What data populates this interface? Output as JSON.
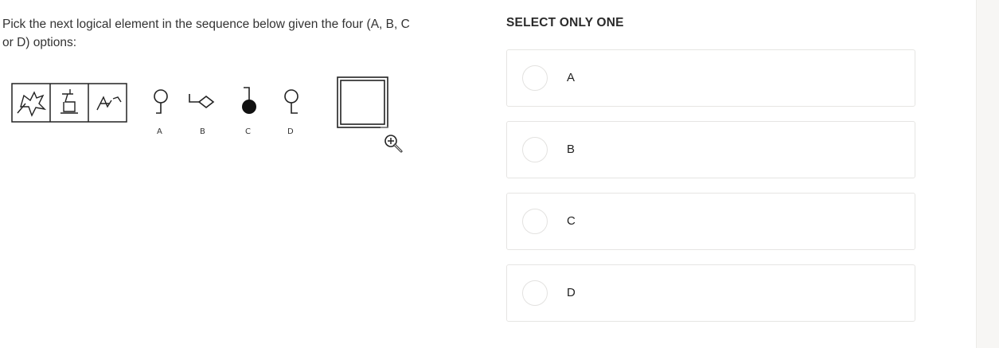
{
  "question": {
    "text": "Pick the next logical element in the sequence below given the four (A, B, C or D) options:"
  },
  "figure": {
    "option_labels": [
      "A",
      "B",
      "C",
      "D"
    ],
    "zoom_icon": "zoom-in-icon"
  },
  "answer_panel": {
    "title": "SELECT ONLY ONE",
    "options": [
      {
        "label": "A"
      },
      {
        "label": "B"
      },
      {
        "label": "C"
      },
      {
        "label": "D"
      }
    ]
  },
  "colors": {
    "text": "#2b2b2b",
    "card_border": "#e6e5e3",
    "gutter": "#f7f6f4"
  }
}
